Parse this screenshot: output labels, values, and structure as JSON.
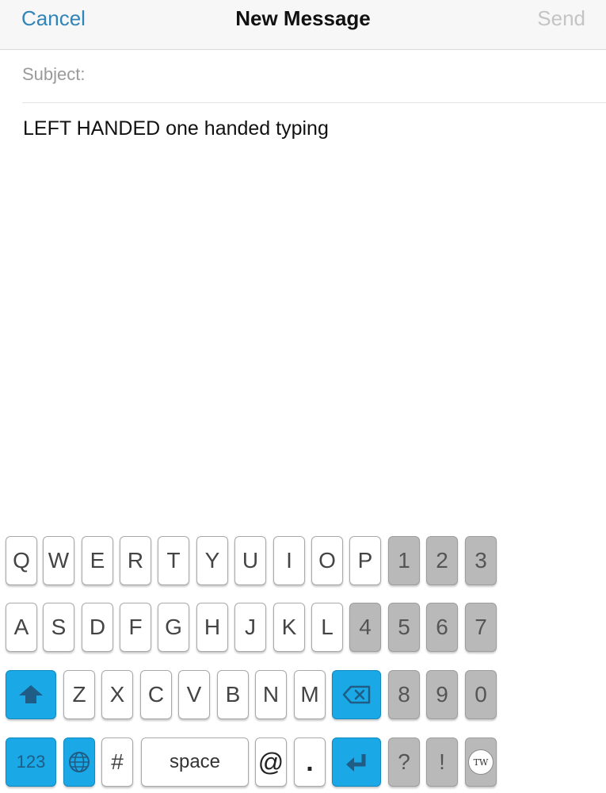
{
  "nav": {
    "cancel_label": "Cancel",
    "title": "New Message",
    "send_label": "Send"
  },
  "compose": {
    "subject_label": "Subject:",
    "body_text": "LEFT HANDED one handed typing"
  },
  "keyboard": {
    "row1_letters": [
      "Q",
      "W",
      "E",
      "R",
      "T",
      "Y",
      "U",
      "I",
      "O",
      "P"
    ],
    "row1_digits": [
      "1",
      "2",
      "3"
    ],
    "row2_letters": [
      "A",
      "S",
      "D",
      "F",
      "G",
      "H",
      "J",
      "K",
      "L"
    ],
    "row2_digits": [
      "4",
      "5",
      "6",
      "7"
    ],
    "row3_letters": [
      "Z",
      "X",
      "C",
      "V",
      "B",
      "N",
      "M"
    ],
    "row3_digits": [
      "8",
      "9",
      "0"
    ],
    "numbers_label": "123",
    "hash_label": "#",
    "space_label": "space",
    "at_label": "@",
    "dot_label": ".",
    "question_label": "?",
    "exclaim_label": "!",
    "tw_badge_label": "TW",
    "icons": {
      "shift": "shift-icon",
      "backspace": "backspace-icon",
      "globe": "globe-icon",
      "return": "return-icon"
    }
  },
  "colors": {
    "accent_blue": "#2f84b8",
    "send_disabled": "#c4c4c4",
    "special_key_blue": "#1aa9e6",
    "digit_key_gray": "#b9b9b9"
  }
}
